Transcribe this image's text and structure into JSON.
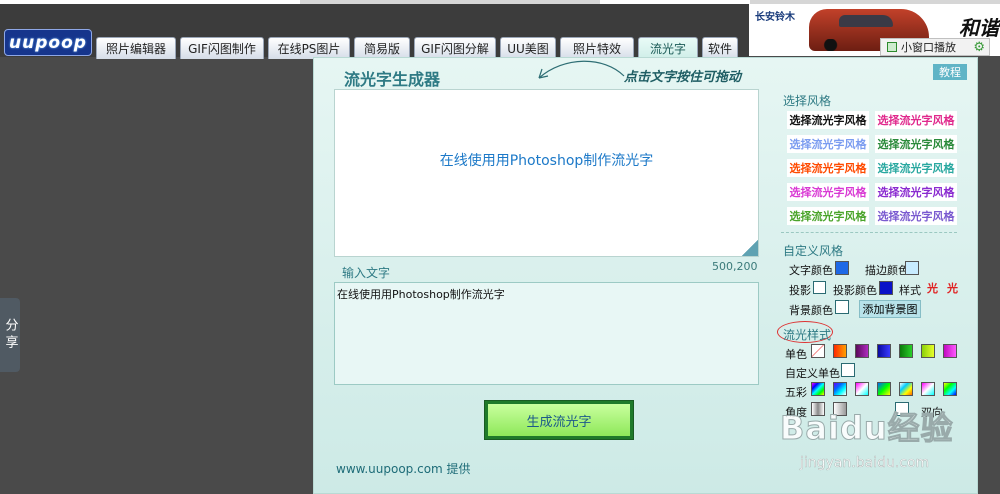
{
  "logo": "uupoop",
  "tabs": [
    {
      "label": "照片编辑器"
    },
    {
      "label": "GIF闪图制作"
    },
    {
      "label": "在线PS图片"
    },
    {
      "label": "简易版"
    },
    {
      "label": "GIF闪图分解"
    },
    {
      "label": "UU美图"
    },
    {
      "label": "照片特效"
    },
    {
      "label": "流光字",
      "active": true
    },
    {
      "label": "软件"
    }
  ],
  "ad": {
    "brand": "长安铃木",
    "slogan": "和谐"
  },
  "mini_player": {
    "label": "小窗口播放"
  },
  "share": {
    "label": "分享"
  },
  "panel": {
    "title": "流光字生成器",
    "hint": "点击文字按住可拖动",
    "help_label": "教程",
    "preview_text": "在线使用用Photoshop制作流光字",
    "canvas_size": "500,200",
    "input_label": "输入文字",
    "input_value": "在线使用用Photoshop制作流光字",
    "generate_label": "生成流光字",
    "footer": "www.uupoop.com  提供"
  },
  "sidebar": {
    "choose_style_title": "选择风格",
    "style_presets": [
      {
        "label": "选择流光字风格",
        "color": "#111111"
      },
      {
        "label": "选择流光字风格",
        "color": "#e0288c"
      },
      {
        "label": "选择流光字风格",
        "color": "#7b9cf0"
      },
      {
        "label": "选择流光字风格",
        "color": "#2a8a3a"
      },
      {
        "label": "选择流光字风格",
        "color": "#ff4a00"
      },
      {
        "label": "选择流光字风格",
        "color": "#29a8a0"
      },
      {
        "label": "选择流光字风格",
        "color": "#d93ad4"
      },
      {
        "label": "选择流光字风格",
        "color": "#8a2ad0"
      },
      {
        "label": "选择流光字风格",
        "color": "#4aa42a"
      },
      {
        "label": "选择流光字风格",
        "color": "#7a5ad0"
      }
    ],
    "custom_title": "自定义风格",
    "text_color_label": "文字颜色",
    "text_color": "#1e68e6",
    "border_color_label": "描边颜色",
    "border_color": "#c8ecff",
    "shadow_label": "投影",
    "shadow_color_label": "投影颜色",
    "shadow_color": "#0a12c8",
    "style_label": "样式",
    "style_glyphs": [
      "光",
      "光"
    ],
    "bg_color_label": "背景颜色",
    "add_bg_label": "添加背景图",
    "flow_title": "流光样式",
    "mono_label": "单色",
    "mono_swatches": [
      "#ffffff",
      "#ff4a00",
      "#7a1a8a",
      "#1a1ad0",
      "#1aa81a",
      "#b5f01a",
      "#e61ad8"
    ],
    "custom_mono_label": "自定义单色",
    "multi_label": "五彩",
    "angle_label": "角度",
    "two_way_label": "双向"
  },
  "watermark": {
    "logo": "Baidu经验",
    "url": "jingyan.baidu.com"
  }
}
